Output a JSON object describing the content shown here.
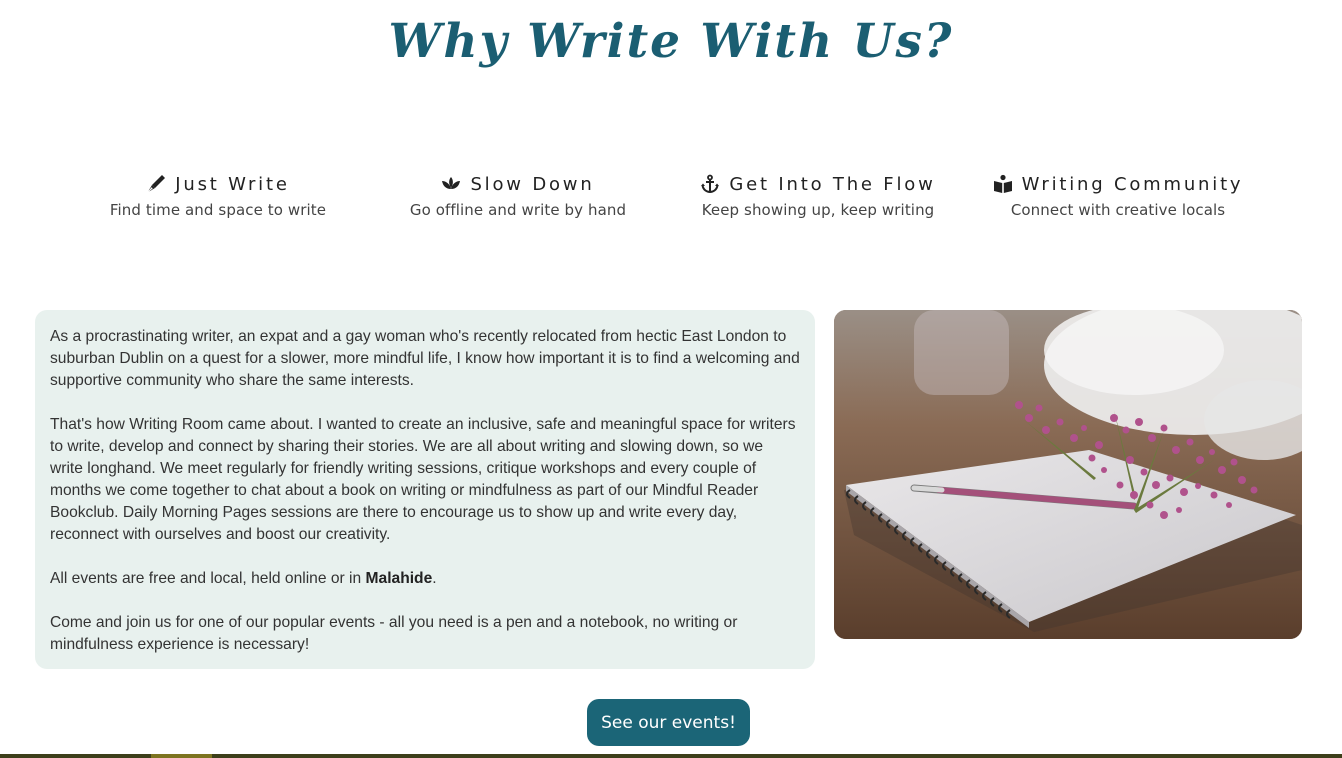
{
  "page_title": "Why Write With Us?",
  "features": [
    {
      "icon": "pen-nib-icon",
      "title": "Just Write",
      "subtitle": "Find time and space to write"
    },
    {
      "icon": "lotus-icon",
      "title": "Slow Down",
      "subtitle": "Go offline and write by hand"
    },
    {
      "icon": "anchor-icon",
      "title": "Get Into The Flow",
      "subtitle": "Keep showing up, keep writing"
    },
    {
      "icon": "book-reader-icon",
      "title": "Writing Community",
      "subtitle": "Connect with creative locals"
    }
  ],
  "about": {
    "p1": "As a procrastinating writer, an expat and a gay woman who's recently relocated from hectic East London to suburban Dublin on a quest for a slower, more mindful life, I know how important it is to find a welcoming and supportive community who share the same interests.",
    "p2": "That's how Writing Room came about. I wanted to create an inclusive, safe and meaningful space for writers to write, develop and connect by sharing their stories. We are all about writing and slowing down, so we write longhand. We meet regularly for friendly writing sessions, critique workshops and every couple of months we come together to chat about a book on writing or mindfulness as part of our Mindful Reader Bookclub. Daily Morning Pages sessions are there to encourage us to show up and write every day, reconnect with ourselves and boost our creativity.",
    "p3_before": "All events are free and local, held online or in ",
    "p3_location": "Malahide",
    "p3_after": ".",
    "p4": "Come and join us for one of our popular events - all you need is a pen and a notebook, no writing or mindfulness experience is necessary!"
  },
  "cta": {
    "label": "See our events!"
  },
  "colors": {
    "title": "#1b5e72",
    "about_bg": "#e8f1ee",
    "button_bg": "#1b6577",
    "footer": "#3d3f1a"
  }
}
